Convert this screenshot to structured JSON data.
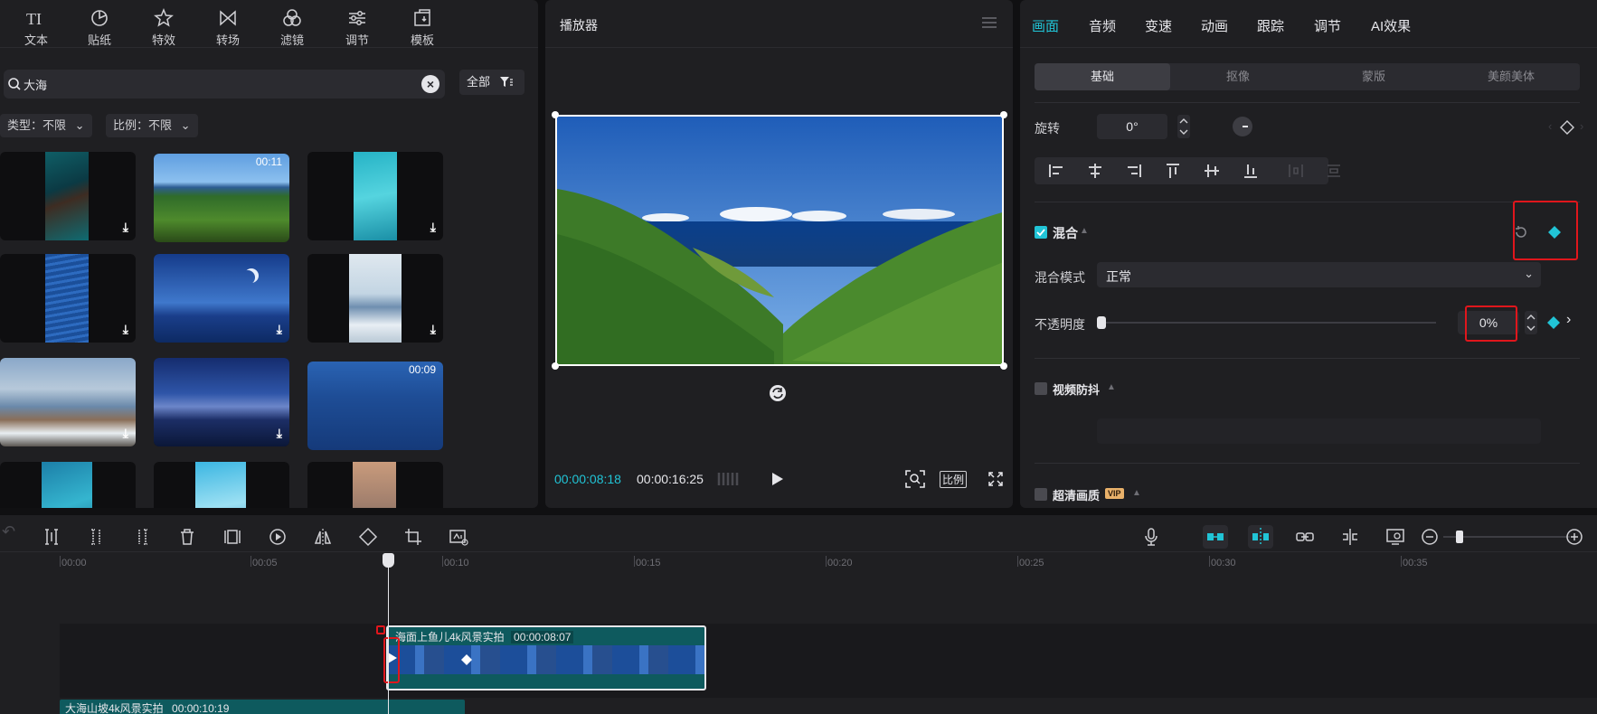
{
  "left_toolbar": {
    "items": [
      {
        "label": "文本",
        "icon": "text-icon"
      },
      {
        "label": "贴纸",
        "icon": "sticker-icon"
      },
      {
        "label": "特效",
        "icon": "effects-icon"
      },
      {
        "label": "转场",
        "icon": "transition-icon"
      },
      {
        "label": "滤镜",
        "icon": "filter-icon"
      },
      {
        "label": "调节",
        "icon": "adjust-icon"
      },
      {
        "label": "模板",
        "icon": "template-icon"
      }
    ]
  },
  "search": {
    "value": "大海",
    "placeholder": "搜索"
  },
  "filter_all": "全部",
  "filters": {
    "type": "类型：不限",
    "ratio": "比例：不限"
  },
  "media": [
    {
      "duration": "",
      "download": true
    },
    {
      "duration": "00:11",
      "download": false
    },
    {
      "duration": "",
      "download": true
    },
    {
      "duration": "",
      "download": true
    },
    {
      "duration": "",
      "download": true
    },
    {
      "duration": "",
      "download": true
    },
    {
      "duration": "",
      "download": true
    },
    {
      "duration": "",
      "download": true
    },
    {
      "duration": "00:09",
      "download": false
    }
  ],
  "player": {
    "title": "播放器",
    "time_current": "00:00:08:18",
    "time_total": "00:00:16:25",
    "ratio_label": "比例"
  },
  "right_tabs": [
    "画面",
    "音频",
    "变速",
    "动画",
    "跟踪",
    "调节",
    "AI效果"
  ],
  "sub_tabs": [
    "基础",
    "抠像",
    "蒙版",
    "美颜美体"
  ],
  "rotate": {
    "label": "旋转",
    "value": "0°"
  },
  "blend": {
    "section_label": "混合",
    "mode_label": "混合模式",
    "mode_value": "正常",
    "opacity_label": "不透明度",
    "opacity_value": "0%",
    "opacity": 0
  },
  "stabilize": {
    "label": "视频防抖"
  },
  "hd": {
    "label": "超清画质",
    "badge": "VIP"
  },
  "colors": {
    "accent": "#21c4d6",
    "highlight": "#e0161c",
    "clip": "#0e5a5e"
  },
  "ruler": [
    "00:00",
    "00:05",
    "00:10",
    "00:15",
    "00:20",
    "00:25",
    "00:30",
    "00:35"
  ],
  "clips": [
    {
      "title": "海面上鱼儿4k风景实拍",
      "duration": "00:00:08:07"
    },
    {
      "title": "大海山坡4k风景实拍",
      "duration": "00:00:10:19"
    }
  ]
}
